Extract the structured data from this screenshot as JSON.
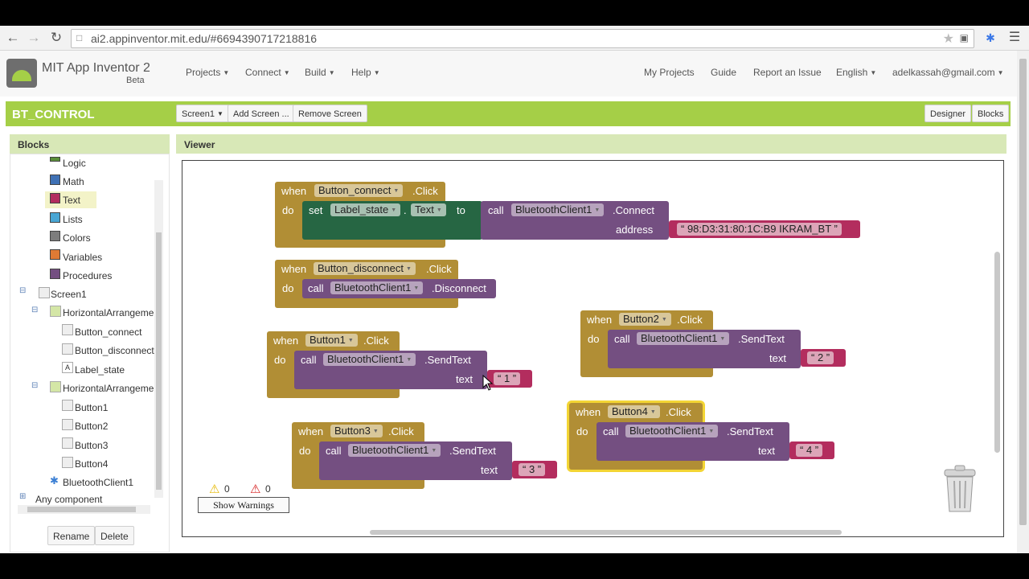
{
  "browser": {
    "url": "ai2.appinventor.mit.edu/#6694390717218816"
  },
  "header": {
    "app_name": "MIT App Inventor 2",
    "beta_label": "Beta",
    "menus": [
      "Projects",
      "Connect",
      "Build",
      "Help"
    ],
    "right_links": [
      "My Projects",
      "Guide",
      "Report an Issue"
    ],
    "language": "English",
    "account": "adelkassah@gmail.com"
  },
  "project_bar": {
    "project_name": "BT_CONTROL",
    "screen_select": "Screen1",
    "add_screen": "Add Screen ...",
    "remove_screen": "Remove Screen",
    "designer": "Designer",
    "blocks": "Blocks"
  },
  "blocks_panel": {
    "title": "Blocks",
    "builtin": [
      {
        "label": "Logic",
        "color": "#5b8f3a"
      },
      {
        "label": "Math",
        "color": "#3f71b5"
      },
      {
        "label": "Text",
        "color": "#b32d5e"
      },
      {
        "label": "Lists",
        "color": "#49a6d4"
      },
      {
        "label": "Colors",
        "color": "#7d7d7d"
      },
      {
        "label": "Variables",
        "color": "#e07a34"
      },
      {
        "label": "Procedures",
        "color": "#744f81"
      }
    ],
    "screen": "Screen1",
    "arrangement1": "HorizontalArrangemer",
    "arrangement1_children": [
      "Button_connect",
      "Button_disconnect",
      "Label_state"
    ],
    "arrangement2": "HorizontalArrangemer",
    "arrangement2_children": [
      "Button1",
      "Button2",
      "Button3",
      "Button4"
    ],
    "bluetooth": "BluetoothClient1",
    "any_component": "Any component",
    "rename": "Rename",
    "delete": "Delete"
  },
  "viewer": {
    "title": "Viewer",
    "warnings_count": "0",
    "errors_count": "0",
    "show_warnings": "Show Warnings"
  },
  "words": {
    "when": "when",
    "do": "do",
    "call": "call",
    "set": "set",
    "to": "to",
    "click": ".Click",
    "text": "text",
    "address": "address",
    "send_text": ".SendText",
    "connect": ".Connect",
    "disconnect": ".Disconnect",
    "text_prop": "Text",
    "dot": "."
  },
  "blocks": {
    "b1": {
      "component": "Button_connect",
      "label_comp": "Label_state",
      "bt": "BluetoothClient1",
      "address_value": "98:D3:31:80:1C:B9 IKRAM_BT"
    },
    "b2": {
      "component": "Button_disconnect",
      "bt": "BluetoothClient1"
    },
    "b3": {
      "component": "Button1",
      "bt": "BluetoothClient1",
      "value": "1"
    },
    "b4": {
      "component": "Button2",
      "bt": "BluetoothClient1",
      "value": "2"
    },
    "b5": {
      "component": "Button3",
      "bt": "BluetoothClient1",
      "value": "3"
    },
    "b6": {
      "component": "Button4",
      "bt": "BluetoothClient1",
      "value": "4"
    }
  }
}
